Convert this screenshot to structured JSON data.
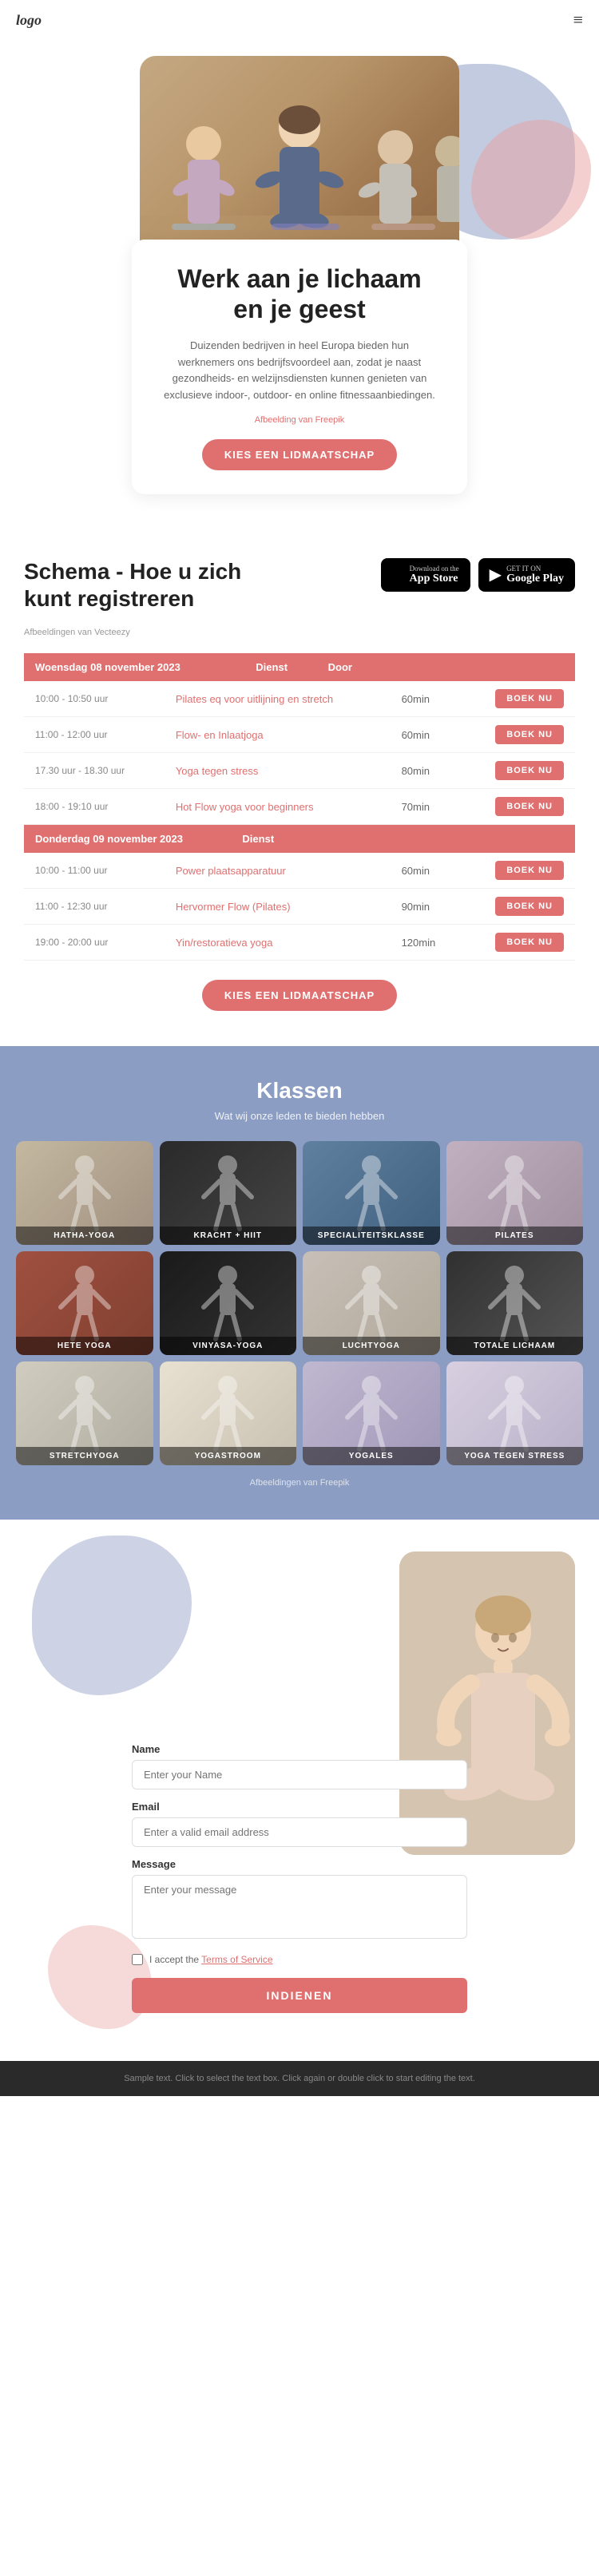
{
  "header": {
    "logo": "logo",
    "hamburger_icon": "≡"
  },
  "hero": {
    "title": "Werk aan je lichaam en je geest",
    "description": "Duizenden bedrijven in heel Europa bieden hun werknemers ons bedrijfsvoordeel aan, zodat je naast gezondheids- en welzijnsdiensten kunnen genieten van exclusieve indoor-, outdoor- en online fitnessaanbiedingen.",
    "image_credit_text": "Afbeelding van Freepik",
    "image_credit_link": "Freepik",
    "cta_button": "KIES EEN LIDMAATSCHAP"
  },
  "schedule": {
    "title": "Schema - Hoe u zich kunt registreren",
    "image_credit": "Afbeeldingen van Vecteezy",
    "app_store": {
      "small": "Download on the",
      "large": "App Store"
    },
    "google_play": {
      "small": "GET IT ON",
      "large": "Google Play"
    },
    "days": [
      {
        "date": "Woensdag 08 november 2023",
        "classes": [
          {
            "time": "10:00 - 10:50 uur",
            "name": "Pilates eq voor uitlijning en stretch",
            "duration": "60min",
            "book": "BOEK NU"
          },
          {
            "time": "11:00 - 12:00 uur",
            "name": "Flow- en Inlaatjoga",
            "duration": "60min",
            "book": "BOEK NU"
          },
          {
            "time": "17.30 uur - 18.30 uur",
            "name": "Yoga tegen stress",
            "duration": "80min",
            "book": "BOEK NU"
          },
          {
            "time": "18:00 - 19:10 uur",
            "name": "Hot Flow yoga voor beginners",
            "duration": "70min",
            "book": "BOEK NU"
          }
        ]
      },
      {
        "date": "Donderdag 09 november 2023",
        "classes": [
          {
            "time": "10:00 - 11:00 uur",
            "name": "Power plaatsapparatuur",
            "duration": "60min",
            "book": "BOEK NU"
          },
          {
            "time": "11:00 - 12:30 uur",
            "name": "Hervormer Flow (Pilates)",
            "duration": "90min",
            "book": "BOEK NU"
          },
          {
            "time": "19:00 - 20:00 uur",
            "name": "Yin/restoratieva yoga",
            "duration": "120min",
            "book": "BOEK NU"
          }
        ]
      }
    ],
    "cta_button": "KIES EEN LIDMAATSCHAP"
  },
  "classes": {
    "title": "Klassen",
    "subtitle": "Wat wij onze leden te bieden hebben",
    "image_credit_text": "Afbeeldingen van Freepik",
    "items": [
      {
        "label": "HATHA-YOGA",
        "color_class": "img-hatha"
      },
      {
        "label": "KRACHT + HIIT",
        "color_class": "img-strength"
      },
      {
        "label": "SPECIALITEITSKLASSE",
        "color_class": "img-special"
      },
      {
        "label": "PILATES",
        "color_class": "img-pilates"
      },
      {
        "label": "HETE YOGA",
        "color_class": "img-hot"
      },
      {
        "label": "VINYASA-YOGA",
        "color_class": "img-vinyasa"
      },
      {
        "label": "LUCHTYOGA",
        "color_class": "img-luchi"
      },
      {
        "label": "TOTALE LICHAAM",
        "color_class": "img-totaal"
      },
      {
        "label": "STRETCHYOGA",
        "color_class": "img-stretch"
      },
      {
        "label": "YOGASTROOM",
        "color_class": "img-yogastroom"
      },
      {
        "label": "YOGALES",
        "color_class": "img-yogales"
      },
      {
        "label": "YOGA TEGEN STRESS",
        "color_class": "img-stress"
      }
    ]
  },
  "contact": {
    "form": {
      "name_label": "Name",
      "name_placeholder": "Enter your Name",
      "email_label": "Email",
      "email_placeholder": "Enter a valid email address",
      "message_label": "Message",
      "message_placeholder": "Enter your message",
      "checkbox_text": "I accept the Terms of Service",
      "checkbox_link_text": "Terms of Service",
      "submit_button": "INDIENEN"
    }
  },
  "footer": {
    "text": "Sample text. Click to select the text box. Click again or double click to start editing the text."
  }
}
